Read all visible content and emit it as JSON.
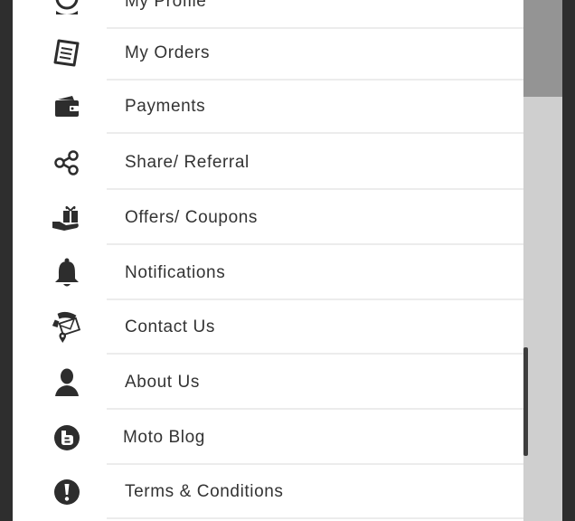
{
  "menu": {
    "items": [
      {
        "label": "My Profile",
        "icon": "profile-icon"
      },
      {
        "label": "My Orders",
        "icon": "orders-icon"
      },
      {
        "label": "Payments",
        "icon": "wallet-icon"
      },
      {
        "label": "Share/ Referral",
        "icon": "share-icon"
      },
      {
        "label": "Offers/ Coupons",
        "icon": "gift-icon"
      },
      {
        "label": "Notifications",
        "icon": "bell-icon"
      },
      {
        "label": "Contact Us",
        "icon": "phone-envelope-icon"
      },
      {
        "label": "About Us",
        "icon": "person-icon"
      },
      {
        "label": "Moto Blog",
        "icon": "blogger-icon"
      },
      {
        "label": "Terms & Conditions",
        "icon": "exclamation-icon"
      }
    ]
  },
  "colors": {
    "drawer_background": "#ffffff",
    "text": "#333333",
    "icon": "#2d2d2d",
    "divider": "#ececec",
    "backdrop_dark": "#949494",
    "backdrop_light": "#cfcfcf"
  }
}
